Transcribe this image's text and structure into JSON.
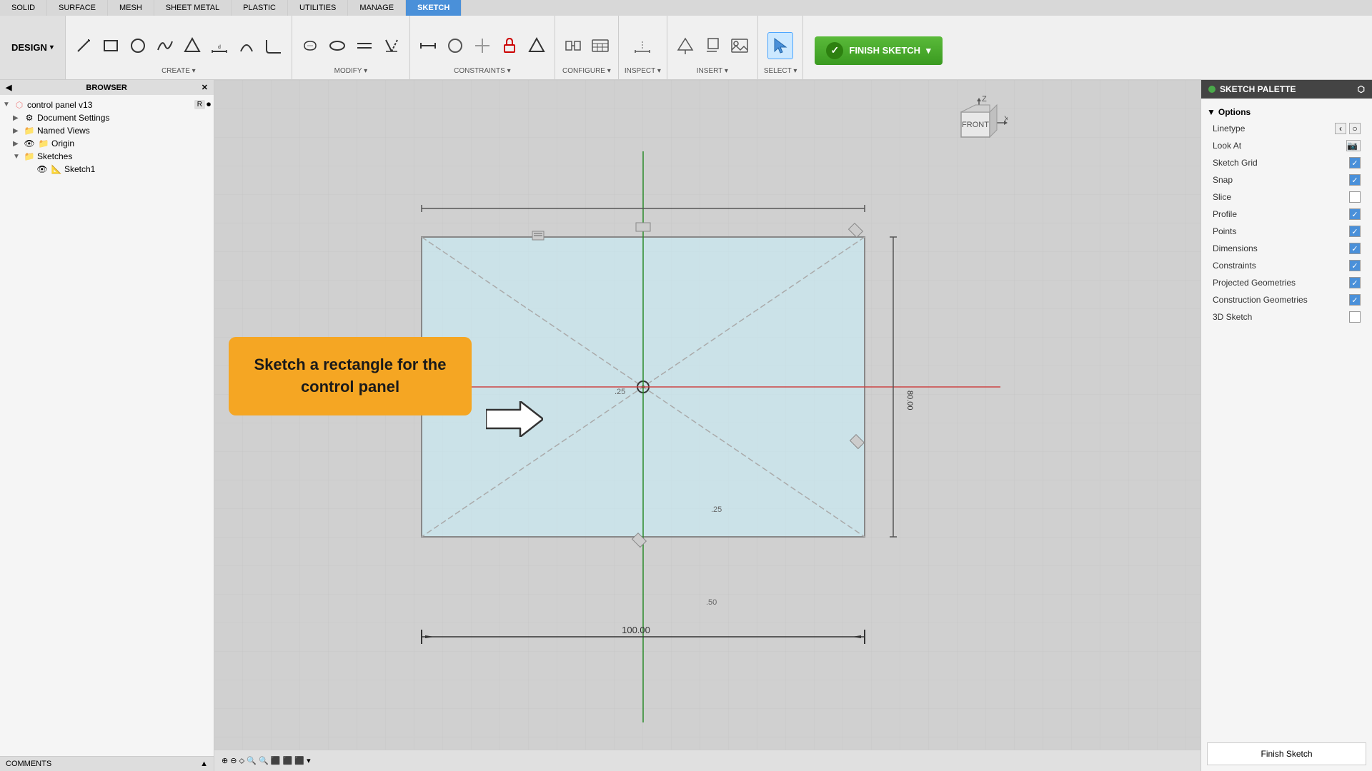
{
  "tabs": {
    "items": [
      "SOLID",
      "SURFACE",
      "MESH",
      "SHEET METAL",
      "PLASTIC",
      "UTILITIES",
      "MANAGE",
      "SKETCH"
    ],
    "active": "SKETCH"
  },
  "design_button": {
    "label": "DESIGN",
    "chevron": "▾"
  },
  "toolbar": {
    "sections": [
      {
        "name": "CREATE",
        "label": "CREATE ▾",
        "icons": [
          "line",
          "rect",
          "circle",
          "spline",
          "triangle",
          "dimension",
          "arc",
          "wave",
          "slot",
          "ellipse",
          "equal",
          "line2",
          "mirror",
          "lock",
          "triangle2"
        ]
      },
      {
        "name": "MODIFY",
        "label": "MODIFY ▾"
      },
      {
        "name": "CONSTRAINTS",
        "label": "CONSTRAINTS ▾"
      },
      {
        "name": "CONFIGURE",
        "label": "CONFIGURE ▾"
      },
      {
        "name": "INSPECT",
        "label": "INSPECT ▾"
      },
      {
        "name": "INSERT",
        "label": "INSERT ▾"
      },
      {
        "name": "SELECT",
        "label": "SELECT ▾"
      },
      {
        "name": "FINISH SKETCH",
        "label": "FINISH SKETCH ▾"
      }
    ],
    "finish_sketch_label": "FINISH SKETCH"
  },
  "browser": {
    "header": "BROWSER",
    "items": [
      {
        "level": 0,
        "label": "control panel v13",
        "icon": "component",
        "expanded": true,
        "has_r": true
      },
      {
        "level": 1,
        "label": "Document Settings",
        "icon": "settings",
        "expanded": false
      },
      {
        "level": 1,
        "label": "Named Views",
        "icon": "folder",
        "expanded": false
      },
      {
        "level": 1,
        "label": "Origin",
        "icon": "folder",
        "expanded": false
      },
      {
        "level": 1,
        "label": "Sketches",
        "icon": "folder",
        "expanded": true
      },
      {
        "level": 2,
        "label": "Sketch1",
        "icon": "sketch",
        "expanded": false
      }
    ]
  },
  "canvas": {
    "sketch_label": "Sketch a rectangle for the control panel",
    "dimension_100": "100.00",
    "dimension_80": "80.00",
    "dimension_25_top": ".25",
    "dimension_50_left": ".50",
    "dimension_25_bottom": ".25",
    "dimension_50_bottom": ".50"
  },
  "view_cube": {
    "face": "FRONT",
    "axis_z": "Z",
    "axis_x": "X"
  },
  "sketch_palette": {
    "header": "SKETCH PALETTE",
    "section_options": "Options",
    "options": [
      {
        "label": "Linetype",
        "checked": false,
        "has_icons": true
      },
      {
        "label": "Look At",
        "checked": false,
        "has_icon": true
      },
      {
        "label": "Sketch Grid",
        "checked": true
      },
      {
        "label": "Snap",
        "checked": true
      },
      {
        "label": "Slice",
        "checked": false
      },
      {
        "label": "Profile",
        "checked": true
      },
      {
        "label": "Points",
        "checked": true
      },
      {
        "label": "Dimensions",
        "checked": true
      },
      {
        "label": "Constraints",
        "checked": true
      },
      {
        "label": "Projected Geometries",
        "checked": true
      },
      {
        "label": "Construction Geometries",
        "checked": true
      },
      {
        "label": "3D Sketch",
        "checked": false
      }
    ],
    "finish_sketch_btn": "Finish Sketch"
  },
  "status_bar": {
    "comments_label": "COMMENTS"
  },
  "colors": {
    "sketch_bg": "rgba(200,235,245,0.7)",
    "tooltip_bg": "#f5a623",
    "tab_active": "#4a90d9",
    "finish_btn": "#3a9a20"
  }
}
